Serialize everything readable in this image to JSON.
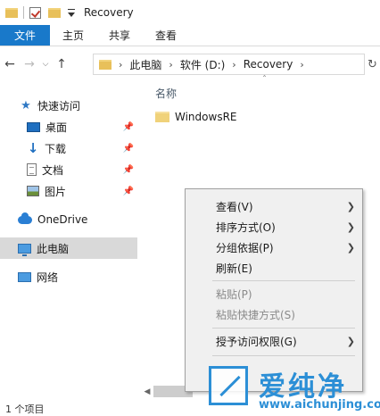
{
  "window": {
    "title": "Recovery"
  },
  "ribbon": {
    "tabs": [
      "文件",
      "主页",
      "共享",
      "查看"
    ]
  },
  "address": {
    "segments": [
      "此电脑",
      "软件 (D:)",
      "Recovery"
    ]
  },
  "nav_pane": {
    "quick_access": "快速访问",
    "quick_items": [
      "桌面",
      "下载",
      "文档",
      "图片"
    ],
    "onedrive": "OneDrive",
    "this_pc": "此电脑",
    "network": "网络"
  },
  "content": {
    "column_name": "名称",
    "files": [
      "WindowsRE"
    ]
  },
  "status": {
    "item_count": "1 个项目"
  },
  "context_menu": {
    "items": [
      {
        "label": "查看(V)",
        "submenu": true,
        "disabled": false
      },
      {
        "label": "排序方式(O)",
        "submenu": true,
        "disabled": false
      },
      {
        "label": "分组依据(P)",
        "submenu": true,
        "disabled": false
      },
      {
        "label": "刷新(E)",
        "submenu": false,
        "disabled": false
      },
      {
        "label": "粘贴(P)",
        "submenu": false,
        "disabled": true
      },
      {
        "label": "粘贴快捷方式(S)",
        "submenu": false,
        "disabled": true
      },
      {
        "label": "授予访问权限(G)",
        "submenu": true,
        "disabled": false
      }
    ]
  },
  "watermark": {
    "brand": "爱纯净",
    "url": "www.aichunjing.com"
  },
  "colors": {
    "accent": "#1979ca",
    "selection": "#d9d9d9",
    "watermark": "#2c8fd6"
  }
}
